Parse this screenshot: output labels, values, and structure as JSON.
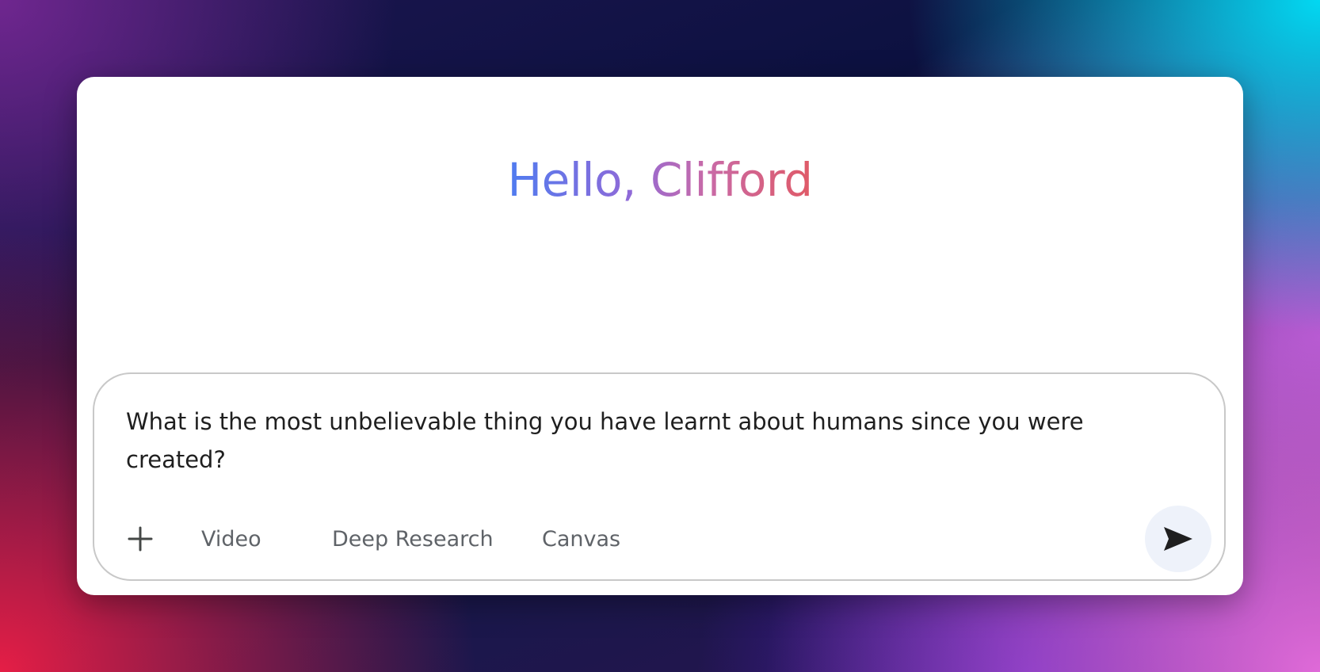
{
  "greeting": {
    "text": "Hello, Clifford",
    "gradient_colors": [
      "#4f7cf0",
      "#8f6ad8",
      "#c86aa8",
      "#e05a66"
    ]
  },
  "composer": {
    "prompt_text": "What is the most unbelievable thing you have learnt about humans since you were created?",
    "add_icon": "plus-icon",
    "tools": [
      {
        "label": "Video"
      },
      {
        "label": "Deep Research"
      },
      {
        "label": "Canvas"
      }
    ],
    "send_icon": "send-arrow-icon"
  }
}
